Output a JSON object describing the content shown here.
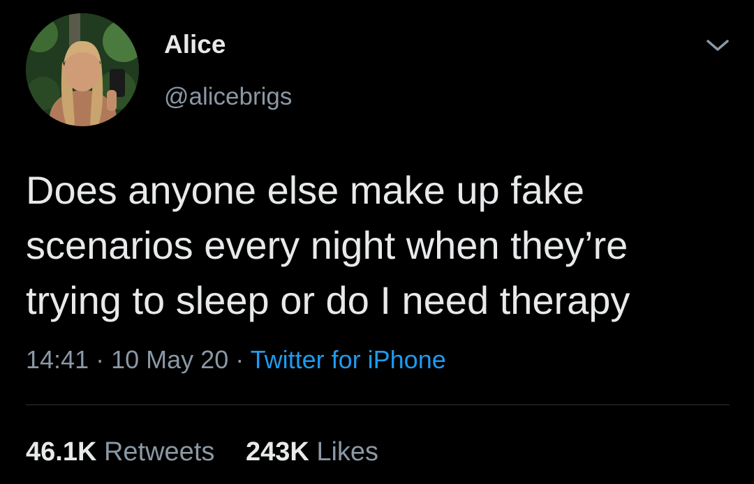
{
  "tweet": {
    "display_name": "Alice",
    "handle": "@alicebrigs",
    "text_lines": [
      "Does anyone else make up fake",
      "scenarios every night when they’re",
      "trying to sleep or do I need therapy"
    ],
    "time": "14:41",
    "separator": "·",
    "date": "10 May 20",
    "source": "Twitter for iPhone"
  },
  "stats": {
    "retweets_count": "46.1K",
    "retweets_label": "Retweets",
    "likes_count": "243K",
    "likes_label": "Likes"
  },
  "icons": {
    "menu": "chevron-down-icon"
  },
  "colors": {
    "background": "#000000",
    "primary_text": "#e7e9ea",
    "secondary_text": "#8b98a5",
    "link": "#1d9bf0",
    "divider": "#2f3336"
  }
}
